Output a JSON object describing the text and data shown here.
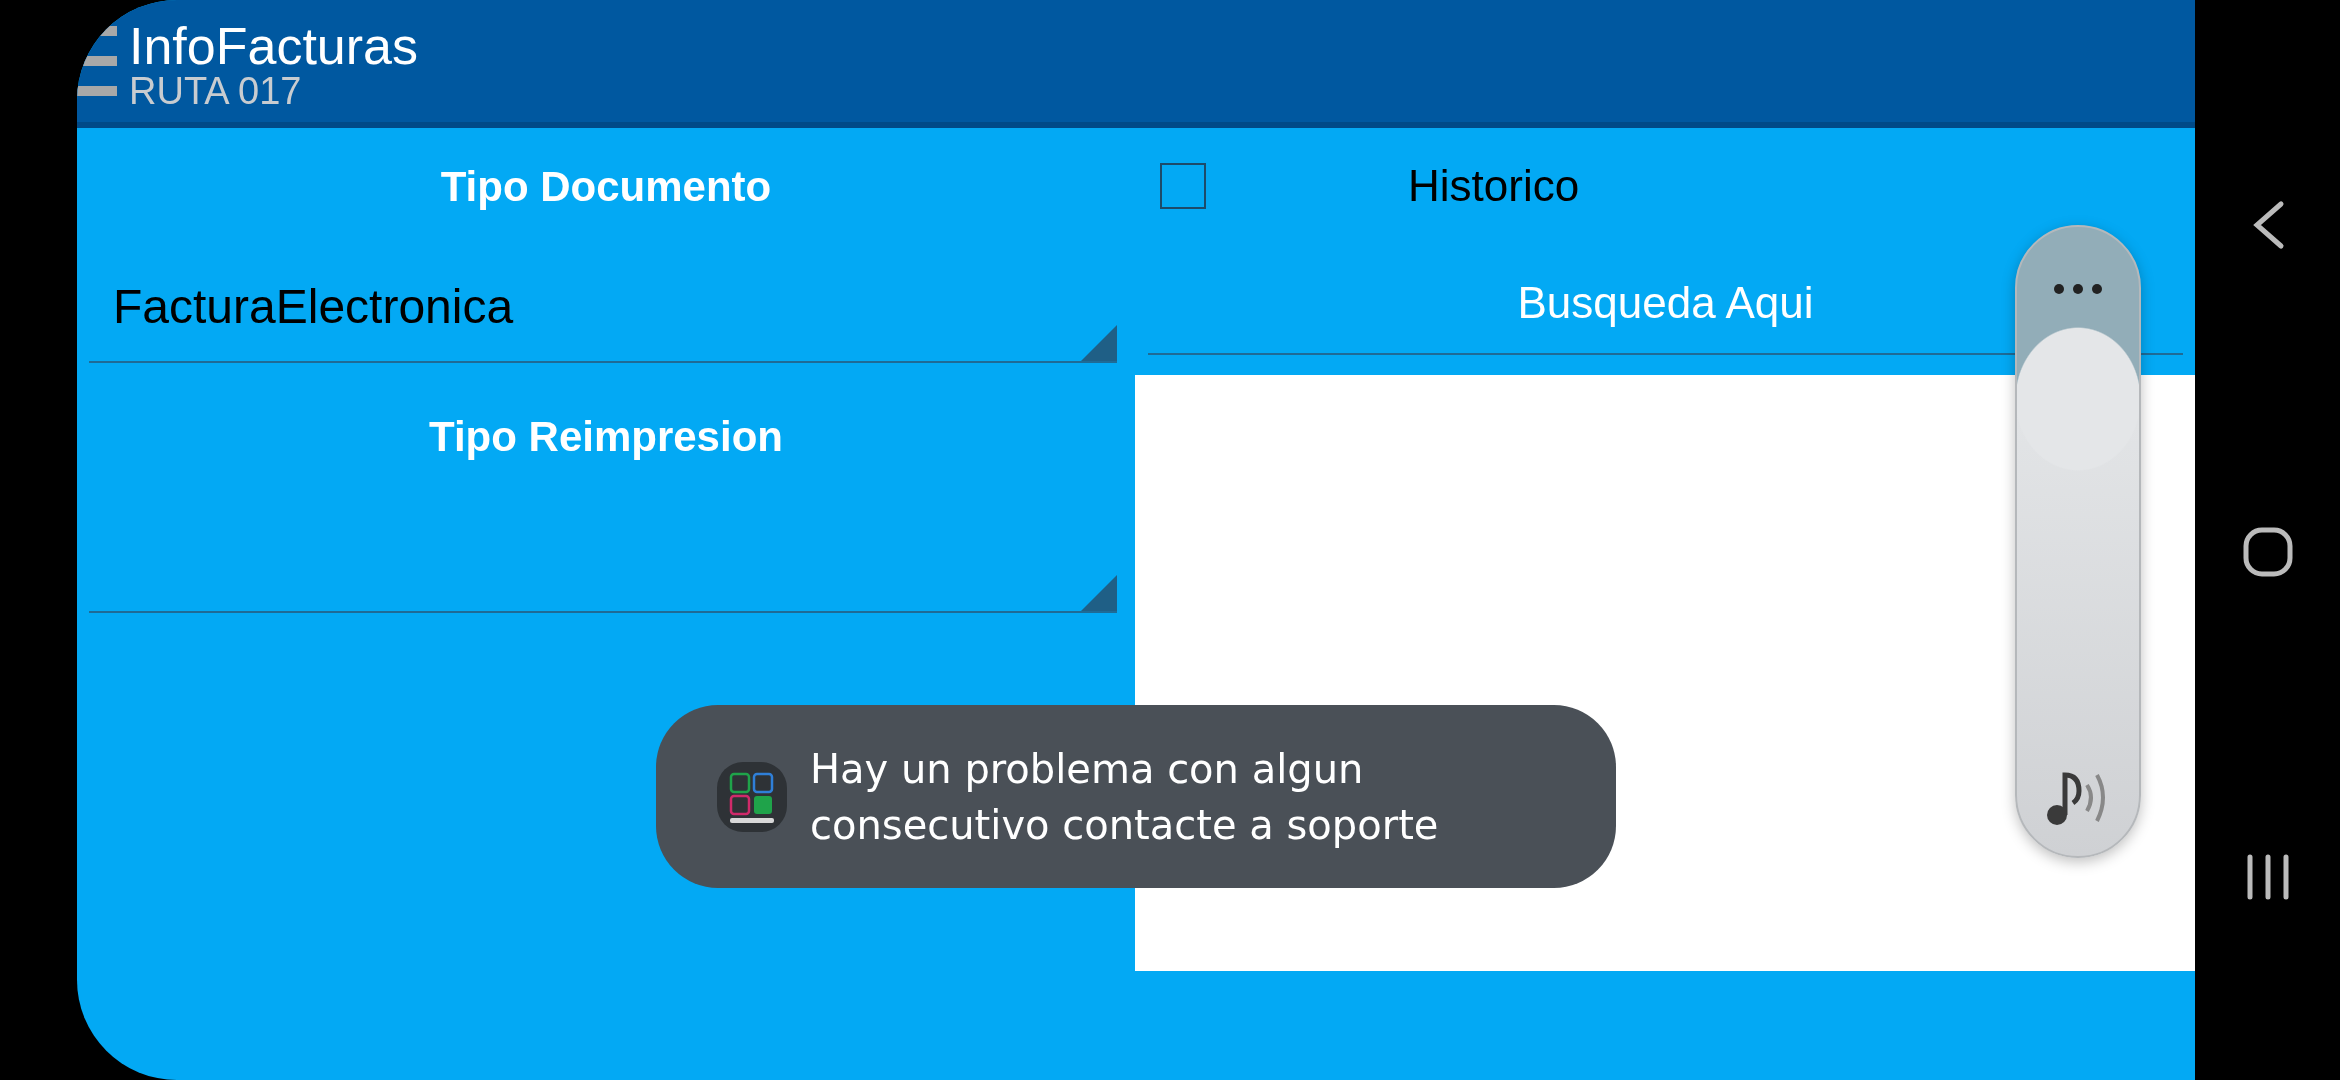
{
  "app_bar": {
    "title": "InfoFacturas",
    "subtitle": "RUTA 017"
  },
  "left": {
    "document_type_label": "Tipo Documento",
    "document_type_value": "FacturaElectronica",
    "reprint_type_label": "Tipo Reimpresion"
  },
  "right": {
    "historico": {
      "label": "Historico",
      "checked": false
    },
    "search": {
      "placeholder": "Busqueda Aqui"
    }
  },
  "toast": {
    "message": "Hay un problema con algun consecutivo contacte a soporte"
  }
}
